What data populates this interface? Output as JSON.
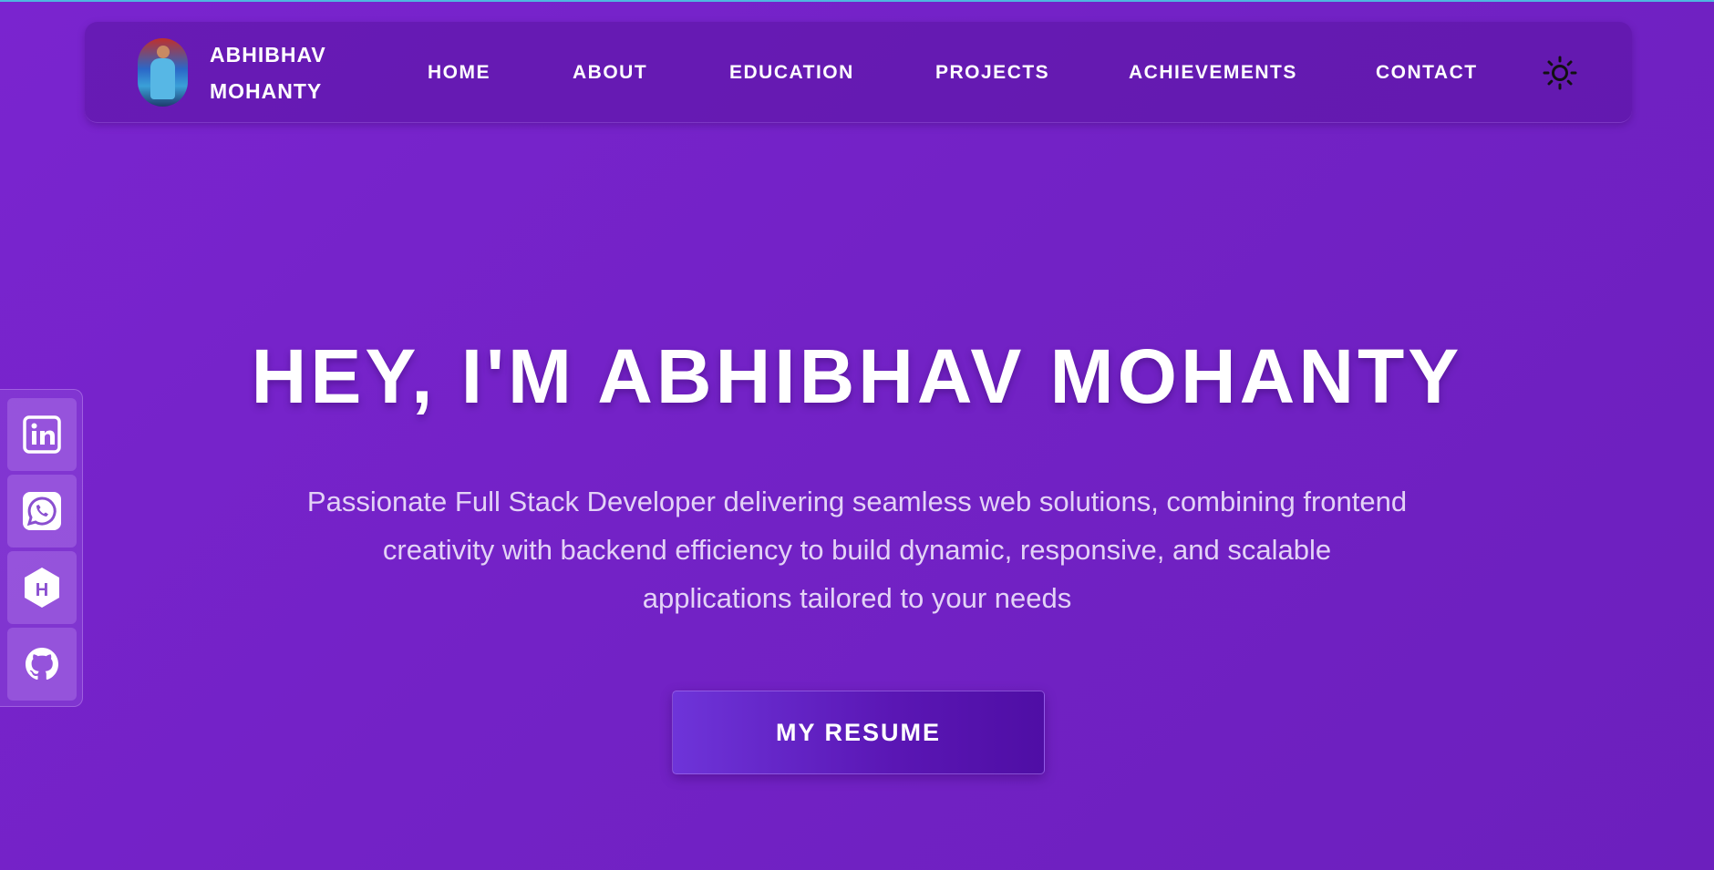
{
  "brand": {
    "name_line1": "ABHIBHAV",
    "name_line2": "MOHANTY"
  },
  "nav": {
    "items": [
      {
        "label": "HOME"
      },
      {
        "label": "ABOUT"
      },
      {
        "label": "EDUCATION"
      },
      {
        "label": "PROJECTS"
      },
      {
        "label": "ACHIEVEMENTS"
      },
      {
        "label": "CONTACT"
      }
    ],
    "theme_toggle_icon": "sun-icon"
  },
  "social": [
    {
      "icon": "linkedin-icon"
    },
    {
      "icon": "whatsapp-icon"
    },
    {
      "icon": "hashnode-icon"
    },
    {
      "icon": "github-icon"
    }
  ],
  "hero": {
    "title": "HEY, I'M ABHIBHAV MOHANTY",
    "subtitle_line1": "Passionate Full Stack Developer delivering seamless web solutions, combining frontend",
    "subtitle_line2": "creativity with backend efficiency to build dynamic, responsive, and scalable",
    "subtitle_line3": "applications tailored to your needs",
    "cta_label": "MY RESUME"
  },
  "colors": {
    "background": "#7322c6",
    "navbar": "#5a14a0",
    "button": "#5a16b4",
    "text": "#ffffff",
    "subtitle": "#e3d2f6"
  }
}
